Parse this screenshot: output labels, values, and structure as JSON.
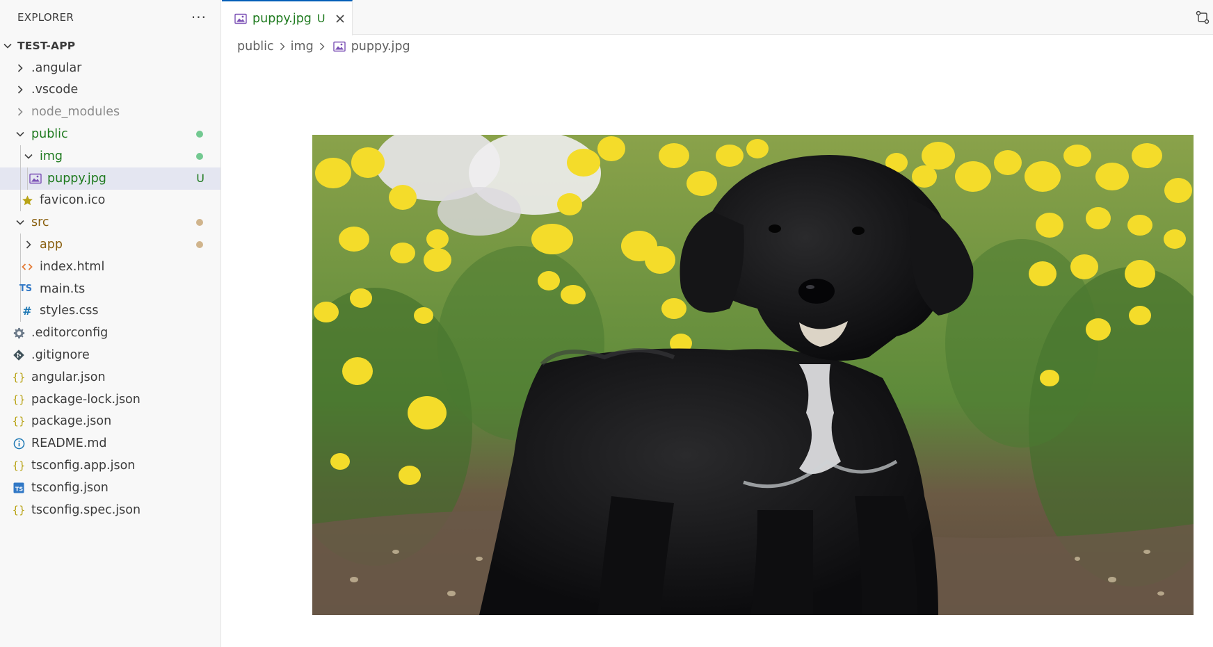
{
  "explorer": {
    "title": "EXPLORER",
    "more": "···",
    "root": "TEST-APP",
    "items": [
      {
        "label": ".angular",
        "kind": "folder-collapsed",
        "depth": 1
      },
      {
        "label": ".vscode",
        "kind": "folder-collapsed",
        "depth": 1
      },
      {
        "label": "node_modules",
        "kind": "folder-collapsed",
        "depth": 1
      },
      {
        "label": "public",
        "kind": "folder-expanded",
        "depth": 1
      },
      {
        "label": "img",
        "kind": "folder-expanded",
        "depth": 2
      },
      {
        "label": "puppy.jpg",
        "kind": "file",
        "depth": 3,
        "icon": "image-icon",
        "badge": "U"
      },
      {
        "label": "favicon.ico",
        "kind": "file",
        "depth": 2,
        "icon": "star-icon"
      },
      {
        "label": "src",
        "kind": "folder-expanded",
        "depth": 1
      },
      {
        "label": "app",
        "kind": "folder-collapsed",
        "depth": 2
      },
      {
        "label": "index.html",
        "kind": "file",
        "depth": 2,
        "icon": "html-icon"
      },
      {
        "label": "main.ts",
        "kind": "file",
        "depth": 2,
        "icon": "typescript-icon"
      },
      {
        "label": "styles.css",
        "kind": "file",
        "depth": 2,
        "icon": "css-icon"
      },
      {
        "label": ".editorconfig",
        "kind": "file",
        "depth": 1,
        "icon": "gear-icon"
      },
      {
        "label": ".gitignore",
        "kind": "file",
        "depth": 1,
        "icon": "git-icon"
      },
      {
        "label": "angular.json",
        "kind": "file",
        "depth": 1,
        "icon": "json-icon"
      },
      {
        "label": "package-lock.json",
        "kind": "file",
        "depth": 1,
        "icon": "json-icon"
      },
      {
        "label": "package.json",
        "kind": "file",
        "depth": 1,
        "icon": "json-icon"
      },
      {
        "label": "README.md",
        "kind": "file",
        "depth": 1,
        "icon": "info-icon"
      },
      {
        "label": "tsconfig.app.json",
        "kind": "file",
        "depth": 1,
        "icon": "json-icon"
      },
      {
        "label": "tsconfig.json",
        "kind": "file",
        "depth": 1,
        "icon": "tsconfig-icon"
      },
      {
        "label": "tsconfig.spec.json",
        "kind": "file",
        "depth": 1,
        "icon": "json-icon"
      }
    ]
  },
  "tab": {
    "label": "puppy.jpg",
    "badge": "U"
  },
  "breadcrumb": {
    "parts": [
      "public",
      "img",
      "puppy.jpg"
    ]
  },
  "colors": {
    "untracked": "#1e7a1e",
    "modified": "#8a6010",
    "accent": "#005fb8",
    "json": "#b8a316",
    "html": "#e37933",
    "typescript": "#3178c6",
    "css": "#1e78b4"
  }
}
